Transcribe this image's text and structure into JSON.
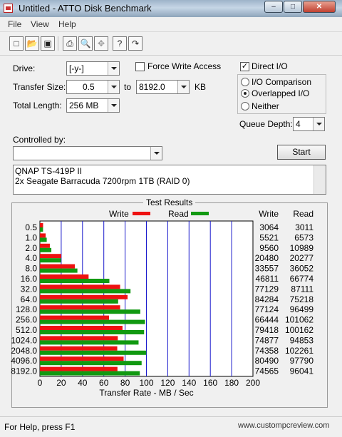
{
  "window": {
    "title": "Untitled - ATTO Disk Benchmark",
    "min": "–",
    "max": "□",
    "close": "✕"
  },
  "menu": [
    "File",
    "View",
    "Help"
  ],
  "toolbar": [
    "new-icon",
    "open-icon",
    "save-icon",
    "print-icon",
    "print-preview-icon",
    "move-icon",
    "help-icon",
    "context-help-icon"
  ],
  "form": {
    "drive_label": "Drive:",
    "drive_value": "[-y-]",
    "transfer_label": "Transfer Size:",
    "transfer_from": "0.5",
    "to_label": "to",
    "transfer_to": "8192.0",
    "kb_label": "KB",
    "length_label": "Total Length:",
    "length_value": "256 MB",
    "force_write": "Force Write Access",
    "direct_io": "Direct I/O",
    "io_comparison": "I/O Comparison",
    "overlapped_io": "Overlapped I/O",
    "neither": "Neither",
    "queue_label": "Queue Depth:",
    "queue_value": "4",
    "controlled_label": "Controlled by:",
    "controlled_value": "",
    "start_label": "Start"
  },
  "description": [
    "QNAP TS-419P II",
    "2x Seagate Barracuda 7200rpm 1TB (RAID 0)"
  ],
  "results_title": "Test Results",
  "statusbar": {
    "text": "For Help, press F1"
  },
  "watermark": "www.custompcreview.com",
  "chart_data": {
    "type": "bar",
    "orientation": "horizontal",
    "categories": [
      "0.5",
      "1.0",
      "2.0",
      "4.0",
      "8.0",
      "16.0",
      "32.0",
      "64.0",
      "128.0",
      "256.0",
      "512.0",
      "1024.0",
      "2048.0",
      "4096.0",
      "8192.0"
    ],
    "series": [
      {
        "name": "Write",
        "color": "#ee1111",
        "values": [
          3064,
          5521,
          9560,
          20480,
          33557,
          46811,
          77129,
          84284,
          77124,
          66444,
          79418,
          74877,
          74358,
          80490,
          74565
        ]
      },
      {
        "name": "Read",
        "color": "#119911",
        "values": [
          3011,
          6573,
          10989,
          20277,
          36052,
          66774,
          87111,
          75218,
          96499,
          101062,
          100162,
          94853,
          102261,
          97790,
          96041
        ]
      }
    ],
    "xlabel": "Transfer Rate - MB / Sec",
    "xlim": [
      0,
      200
    ],
    "xticks": [
      0,
      20,
      40,
      60,
      80,
      100,
      120,
      140,
      160,
      180,
      200
    ],
    "column_headers": [
      "Write",
      "Read"
    ],
    "grid": true,
    "legend": "top"
  }
}
